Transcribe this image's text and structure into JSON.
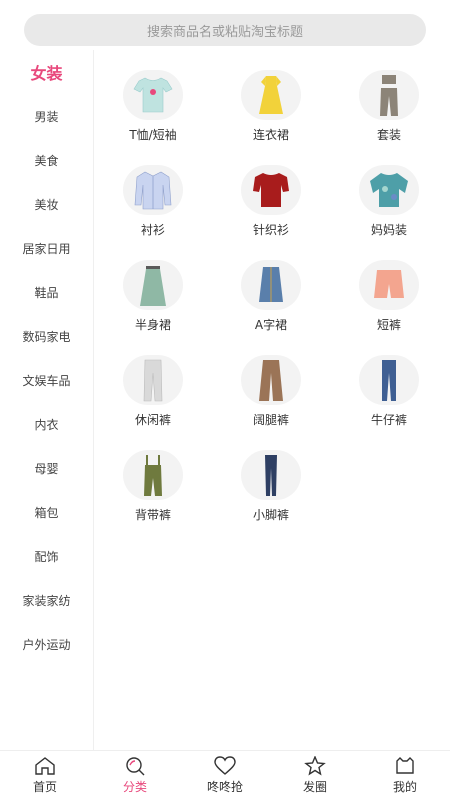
{
  "search": {
    "placeholder": "搜索商品名或粘贴淘宝标题"
  },
  "sidebar": {
    "items": [
      {
        "label": "女装",
        "active": true
      },
      {
        "label": "男装"
      },
      {
        "label": "美食"
      },
      {
        "label": "美妆"
      },
      {
        "label": "居家日用"
      },
      {
        "label": "鞋品"
      },
      {
        "label": "数码家电"
      },
      {
        "label": "文娱车品"
      },
      {
        "label": "内衣"
      },
      {
        "label": "母婴"
      },
      {
        "label": "箱包"
      },
      {
        "label": "配饰"
      },
      {
        "label": "家装家纺"
      },
      {
        "label": "户外运动"
      }
    ]
  },
  "categories": [
    {
      "label": "T恤/短袖",
      "icon": "tshirt-icon",
      "color": "#bfe3e0"
    },
    {
      "label": "连衣裙",
      "icon": "dress-icon",
      "color": "#f2d23a"
    },
    {
      "label": "套装",
      "icon": "set-icon",
      "color": "#8c8478"
    },
    {
      "label": "衬衫",
      "icon": "shirt-icon",
      "color": "#c9d4f0"
    },
    {
      "label": "针织衫",
      "icon": "knit-sweater-icon",
      "color": "#a81c1c"
    },
    {
      "label": "妈妈装",
      "icon": "mom-top-icon",
      "color": "#4e9fa8"
    },
    {
      "label": "半身裙",
      "icon": "skirt-icon",
      "color": "#8fb8a5"
    },
    {
      "label": "A字裙",
      "icon": "a-line-skirt-icon",
      "color": "#5a7fab"
    },
    {
      "label": "短裤",
      "icon": "shorts-icon",
      "color": "#f3a58f"
    },
    {
      "label": "休闲裤",
      "icon": "casual-pants-icon",
      "color": "#d9d9d9"
    },
    {
      "label": "阔腿裤",
      "icon": "wide-leg-pants-icon",
      "color": "#9b7457"
    },
    {
      "label": "牛仔裤",
      "icon": "jeans-icon",
      "color": "#3f5f93"
    },
    {
      "label": "背带裤",
      "icon": "overalls-icon",
      "color": "#6f7a3e"
    },
    {
      "label": "小脚裤",
      "icon": "skinny-pants-icon",
      "color": "#2e3f63"
    }
  ],
  "tabbar": {
    "items": [
      {
        "label": "首页",
        "icon": "home-icon"
      },
      {
        "label": "分类",
        "icon": "category-search-icon",
        "active": true
      },
      {
        "label": "咚咚抢",
        "icon": "heart-icon"
      },
      {
        "label": "发圈",
        "icon": "star-icon"
      },
      {
        "label": "我的",
        "icon": "profile-icon"
      }
    ]
  },
  "colors": {
    "accent": "#e8487c"
  }
}
